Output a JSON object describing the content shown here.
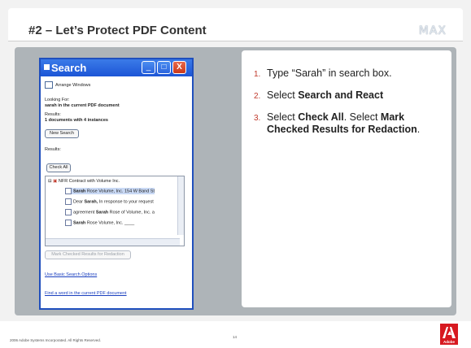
{
  "slide": {
    "title": "#2 – Let’s Protect PDF Content",
    "logo_text": "MAX",
    "footer_copyright": "2006 Adobe Systems Incorporated.  All Rights Reserved.",
    "page_number": "14",
    "adobe_logo_text": "Adobe"
  },
  "search_window": {
    "title": "Search",
    "buttons": {
      "minimize": "_",
      "maximize": "□",
      "close": "X"
    },
    "arrange_windows": "Arrange Windows",
    "looking_for_label": "Looking For:",
    "looking_for_value": "sarah in the current PDF document",
    "results_label": "Results:",
    "results_value": "1 documents with 4 instances",
    "new_search_button": "New Search",
    "results_label_2": "Results:",
    "check_all_button": "Check All",
    "tree": {
      "root": "NFR Contract with Volume Inc.",
      "items": [
        {
          "bold": "Sarah",
          "rest": " Rose Volume, Inc. 154 W Band St"
        },
        {
          "prefix": "Dear ",
          "bold": "Sarah,",
          "rest": " In response to your request"
        },
        {
          "prefix": "agreement ",
          "bold": "Sarah",
          "rest": " Rose of Volume, Inc. a"
        },
        {
          "bold": "Sarah",
          "rest": " Rose Volume, Inc. ____"
        }
      ]
    },
    "mark_button": "Mark Checked Results for Redaction",
    "link_basic": "Use Basic Search Options",
    "link_find": "Find a word in the current PDF document"
  },
  "instructions": {
    "steps": [
      {
        "num": "1.",
        "text": "Type “Sarah”  in search box."
      },
      {
        "num": "2.",
        "pre": "Select ",
        "bold": "Search and React"
      },
      {
        "num": "3.",
        "pre": "Select ",
        "bold": "Check All",
        "mid": ". Select ",
        "bold2": "Mark Checked Results for Redaction",
        "post": "."
      }
    ]
  },
  "colors": {
    "accent_red": "#c0392b",
    "window_blue": "#1c55d6",
    "panel_gray": "#aeb4b8"
  }
}
